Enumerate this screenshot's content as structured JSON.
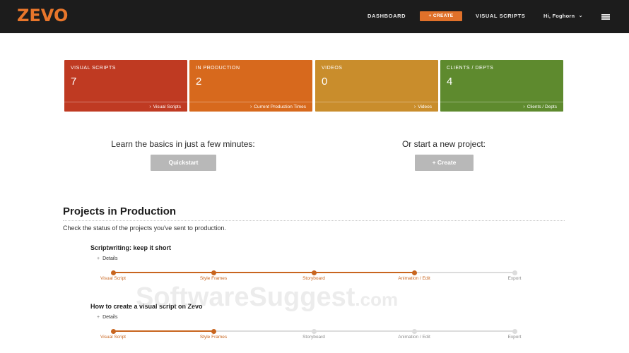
{
  "app": {
    "logo": "ZEVO"
  },
  "nav": {
    "dashboard": "DASHBOARD",
    "create": "+ CREATE",
    "visual_scripts": "VISUAL SCRIPTS",
    "user": "Hi, Foghorn",
    "user_chevron": "⌄"
  },
  "cards": [
    {
      "label": "VISUAL SCRIPTS",
      "value": "7",
      "link": "Visual Scripts",
      "color": "#bf3a22"
    },
    {
      "label": "IN PRODUCTION",
      "value": "2",
      "link": "Current Production Times",
      "color": "#d7691d"
    },
    {
      "label": "VIDEOS",
      "value": "0",
      "link": "Videos",
      "color": "#c98d2c"
    },
    {
      "label": "CLIENTS / DEPTS",
      "value": "4",
      "link": "Clients / Depts",
      "color": "#5e8a2e"
    }
  ],
  "card_arrow": "›",
  "prompts": {
    "learn": "Learn the basics in just a few minutes:",
    "quickstart_button": "Quickstart",
    "start": "Or start a new project:",
    "create_button": "+ Create"
  },
  "projects_section": {
    "title": "Projects in Production",
    "description": "Check the status of the projects you've sent to production."
  },
  "details_plus": "+",
  "projects": [
    {
      "title": "Scriptwriting: keep it short",
      "details_label": "Details",
      "progress": 0.75,
      "steps": [
        {
          "label": "Visual Script",
          "done": true
        },
        {
          "label": "Style Frames",
          "done": true
        },
        {
          "label": "Storyboard",
          "done": true
        },
        {
          "label": "Animation / Edit",
          "done": true
        },
        {
          "label": "Export",
          "done": false
        }
      ]
    },
    {
      "title": "How to create a visual script on Zevo",
      "details_label": "Details",
      "progress": 0.25,
      "steps": [
        {
          "label": "Visual Script",
          "done": true
        },
        {
          "label": "Style Frames",
          "done": true
        },
        {
          "label": "Storyboard",
          "done": false
        },
        {
          "label": "Animation / Edit",
          "done": false
        },
        {
          "label": "Export",
          "done": false
        }
      ]
    }
  ],
  "watermark": {
    "text": "SoftwareSuggest",
    "suffix": ".com"
  },
  "colors": {
    "accent": "#e0712a",
    "progress": "#c8651f",
    "topbar": "#1c1c1c"
  }
}
